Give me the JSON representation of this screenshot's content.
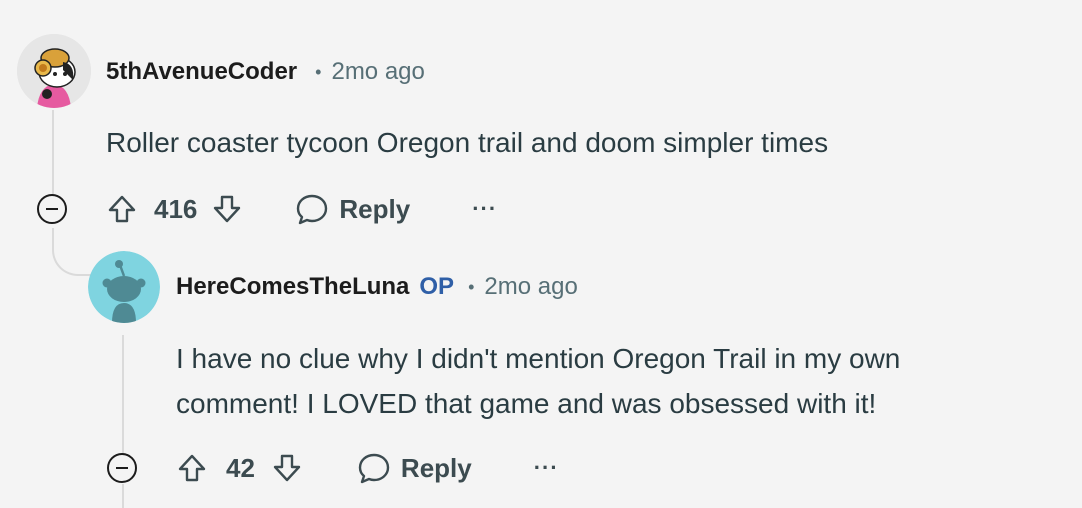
{
  "comments": [
    {
      "author": "5thAvenueCoder",
      "separator": "•",
      "time": "2mo ago",
      "body": "Roller coaster tycoon Oregon trail and doom simpler times",
      "score": "416",
      "reply_label": "Reply",
      "more_label": "···",
      "avatar_icon": "snoo-avatar-hat-icon"
    },
    {
      "author": "HereComesTheLuna",
      "badge": "OP",
      "separator": "•",
      "time": "2mo ago",
      "body_lines": [
        "I have no clue why I didn't mention Oregon Trail in my own",
        "comment! I LOVED that game and was obsessed with it!"
      ],
      "score": "42",
      "reply_label": "Reply",
      "more_label": "···",
      "avatar_icon": "default-snoo-avatar-icon"
    }
  ],
  "colors": {
    "background": "#f4f4f4",
    "op_badge": "#2f5fa7",
    "meta_text": "#576f76",
    "thread_line": "#dadada",
    "avatar_teal": "#7fd4e0"
  }
}
